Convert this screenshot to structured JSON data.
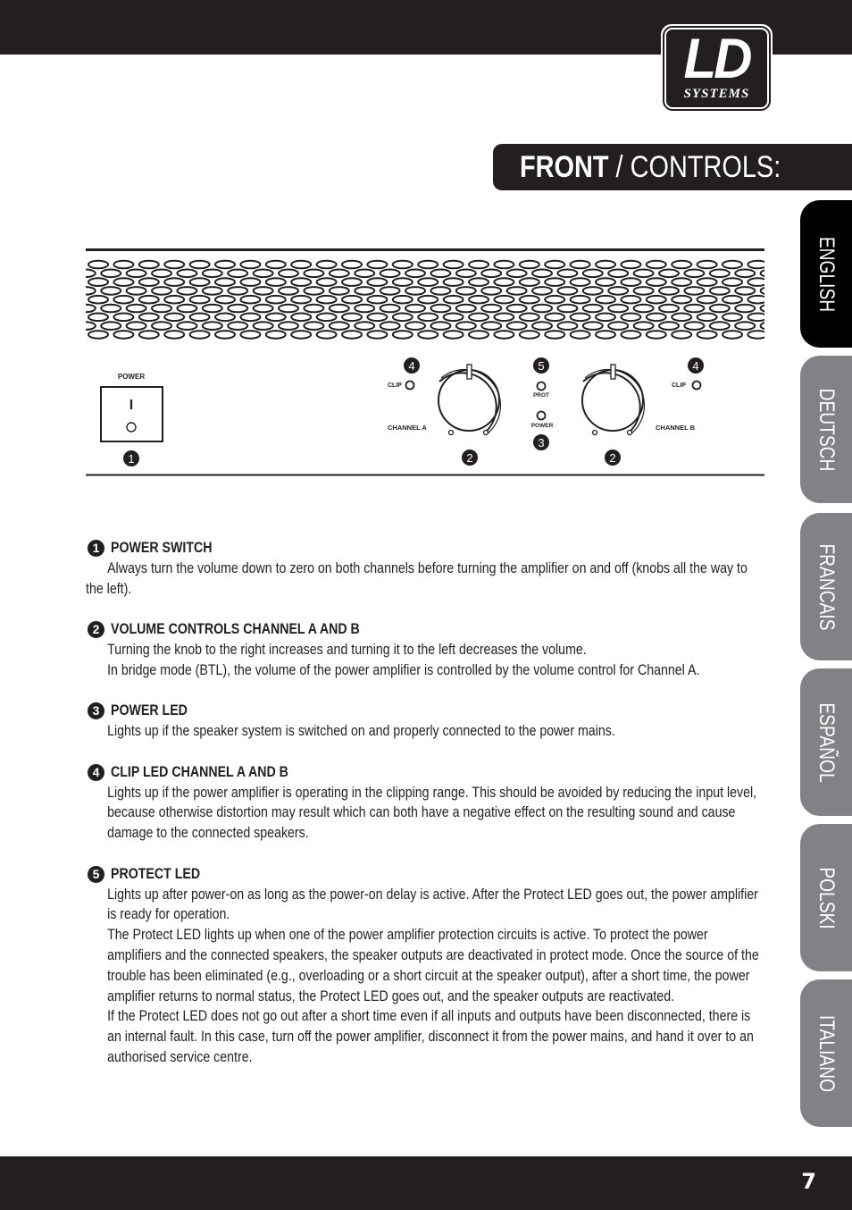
{
  "header": {
    "logo": {
      "main": "LD",
      "sub": "SYSTEMS"
    },
    "title_strong": "FRONT",
    "title_light": " / CONTROLS:"
  },
  "language_tabs": [
    {
      "label": "ENGLISH",
      "active": true
    },
    {
      "label": "DEUTSCH",
      "active": false
    },
    {
      "label": "FRANCAIS",
      "active": false
    },
    {
      "label": "ESPAÑOL",
      "active": false
    },
    {
      "label": "POLSKI",
      "active": false
    },
    {
      "label": "ITALIANO",
      "active": false
    }
  ],
  "diagram": {
    "power_label": "POWER",
    "switch_on_symbol": "I",
    "switch_off_symbol": "O",
    "clip_label": "CLIP",
    "channel_a_label": "CHANNEL  A",
    "channel_b_label": "CHANNEL  B",
    "prot_label": "PROT",
    "power_led_label": "POWER",
    "callouts": {
      "power_switch": "1",
      "volume_a": "2",
      "volume_b": "2",
      "power_led": "3",
      "clip_a": "4",
      "clip_b": "4",
      "protect_led": "5"
    }
  },
  "sections": [
    {
      "num": "1",
      "title": "POWER SWITCH",
      "paragraphs": [
        "Always turn the volume down to zero on both channels before turning the amplifier on and off (knobs all the way to the left)."
      ]
    },
    {
      "num": "2",
      "title": "VOLUME CONTROLS CHANNEL A AND B",
      "paragraphs": [
        "Turning the knob to the right increases and turning it to the left decreases the volume.",
        "In bridge mode (BTL), the volume of the power amplifier is controlled by the volume control for Channel A."
      ]
    },
    {
      "num": "3",
      "title": "POWER LED",
      "paragraphs": [
        "Lights up if the speaker system is switched on and properly connected to the power mains."
      ]
    },
    {
      "num": "4",
      "title": "CLIP LED CHANNEL A AND B",
      "paragraphs": [
        "Lights up if the power amplifier is operating in the clipping range. This should be avoided by reducing the input level, because otherwise distortion may result which can both have a negative effect on the resulting sound and cause damage to the connected speakers."
      ]
    },
    {
      "num": "5",
      "title": "PROTECT LED",
      "paragraphs": [
        "Lights up after power-on as long as the power-on delay is active. After the Protect LED goes out, the power amplifier is ready for operation.",
        "The Protect LED lights up when one of the power amplifier protection circuits is active. To protect the power amplifiers and the connected speakers, the speaker outputs are deactivated in protect mode. Once the source of the trouble has been eliminated (e.g., overloading or a short circuit at the speaker output), after a short time, the power amplifier returns to normal status, the Protect LED goes out, and the speaker outputs are reactivated.",
        "If the Protect LED does not go out after a short time even if all inputs and outputs have been disconnected, there is an internal fault. In this case, turn off the power amplifier, disconnect it from the power mains, and hand it over to an authorised service centre."
      ]
    }
  ],
  "footer": {
    "page_number": "7"
  }
}
